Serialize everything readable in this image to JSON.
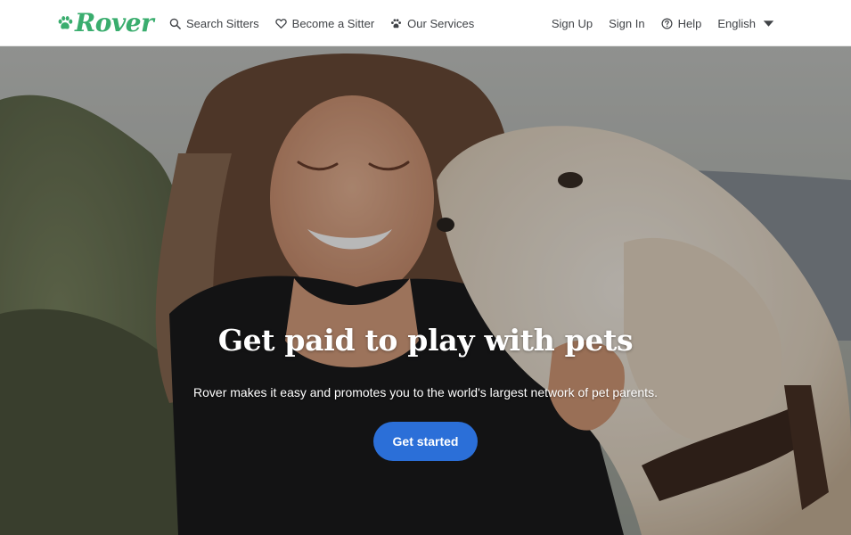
{
  "brand": {
    "name": "Rover",
    "color": "#3aad6e"
  },
  "nav": {
    "left": [
      {
        "label": "Search Sitters",
        "icon": "search-icon"
      },
      {
        "label": "Become a Sitter",
        "icon": "heart-icon"
      },
      {
        "label": "Our Services",
        "icon": "paw-icon"
      }
    ],
    "right": {
      "sign_up": "Sign Up",
      "sign_in": "Sign In",
      "help": "Help",
      "help_icon": "question-circle-icon",
      "language": "English"
    }
  },
  "hero": {
    "title": "Get paid to play with pets",
    "subtitle": "Rover makes it easy and promotes you to the world's largest network of pet parents.",
    "cta_label": "Get started",
    "cta_color": "#2b6fd8",
    "image": "photo of a smiling woman being kissed by a white golden retriever"
  }
}
